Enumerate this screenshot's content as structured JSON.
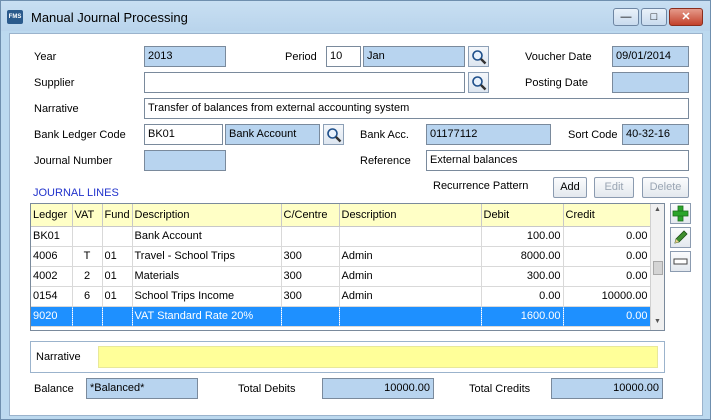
{
  "window": {
    "title": "Manual Journal Processing",
    "app_icon_text": "FMS"
  },
  "header": {
    "year_label": "Year",
    "year_value": "2013",
    "period_label": "Period",
    "period_number": "10",
    "period_name": "Jan",
    "voucher_date_label": "Voucher Date",
    "voucher_date_value": "09/01/2014",
    "supplier_label": "Supplier",
    "supplier_value": "",
    "posting_date_label": "Posting Date",
    "posting_date_value": "",
    "narrative_label": "Narrative",
    "narrative_value": "Transfer of balances from external accounting system",
    "bank_ledger_label": "Bank Ledger Code",
    "bank_ledger_code": "BK01",
    "bank_ledger_name": "Bank Account",
    "bank_acc_label": "Bank Acc.",
    "bank_acc_value": "01177112",
    "sort_code_label": "Sort Code",
    "sort_code_value": "40-32-16",
    "journal_number_label": "Journal Number",
    "journal_number_value": "",
    "reference_label": "Reference",
    "reference_value": "External balances"
  },
  "journal_lines": {
    "title": "JOURNAL LINES",
    "recurrence_label": "Recurrence Pattern",
    "add_label": "Add",
    "edit_label": "Edit",
    "delete_label": "Delete",
    "columns": [
      "Ledger",
      "VAT",
      "Fund",
      "Description",
      "C/Centre",
      "Description",
      "Debit",
      "Credit"
    ],
    "rows": [
      [
        "BK01",
        "",
        "",
        "Bank Account",
        "",
        "",
        "100.00",
        "0.00"
      ],
      [
        "4006",
        "T",
        "01",
        "Travel - School Trips",
        "300",
        "Admin",
        "8000.00",
        "0.00"
      ],
      [
        "4002",
        "2",
        "01",
        "Materials",
        "300",
        "Admin",
        "300.00",
        "0.00"
      ],
      [
        "0154",
        "6",
        "01",
        "School Trips Income",
        "300",
        "Admin",
        "0.00",
        "10000.00"
      ],
      [
        "9020",
        "",
        "",
        "VAT Standard Rate 20%",
        "",
        "",
        "1600.00",
        "0.00"
      ]
    ],
    "selected_row": 4
  },
  "line_narrative": {
    "label": "Narrative",
    "value": ""
  },
  "footer": {
    "balance_label": "Balance",
    "balance_value": "*Balanced*",
    "total_debits_label": "Total Debits",
    "total_debits_value": "10000.00",
    "total_credits_label": "Total Credits",
    "total_credits_value": "10000.00"
  },
  "colors": {
    "readonly_field": "#b8d4ef",
    "header_row": "#ffffc6",
    "selected_row": "#1e90ff",
    "section_title": "#2233cc",
    "narrative_highlight": "#ffff99"
  },
  "icons": [
    "search-icon",
    "plus-icon",
    "pencil-icon",
    "minus-icon"
  ]
}
